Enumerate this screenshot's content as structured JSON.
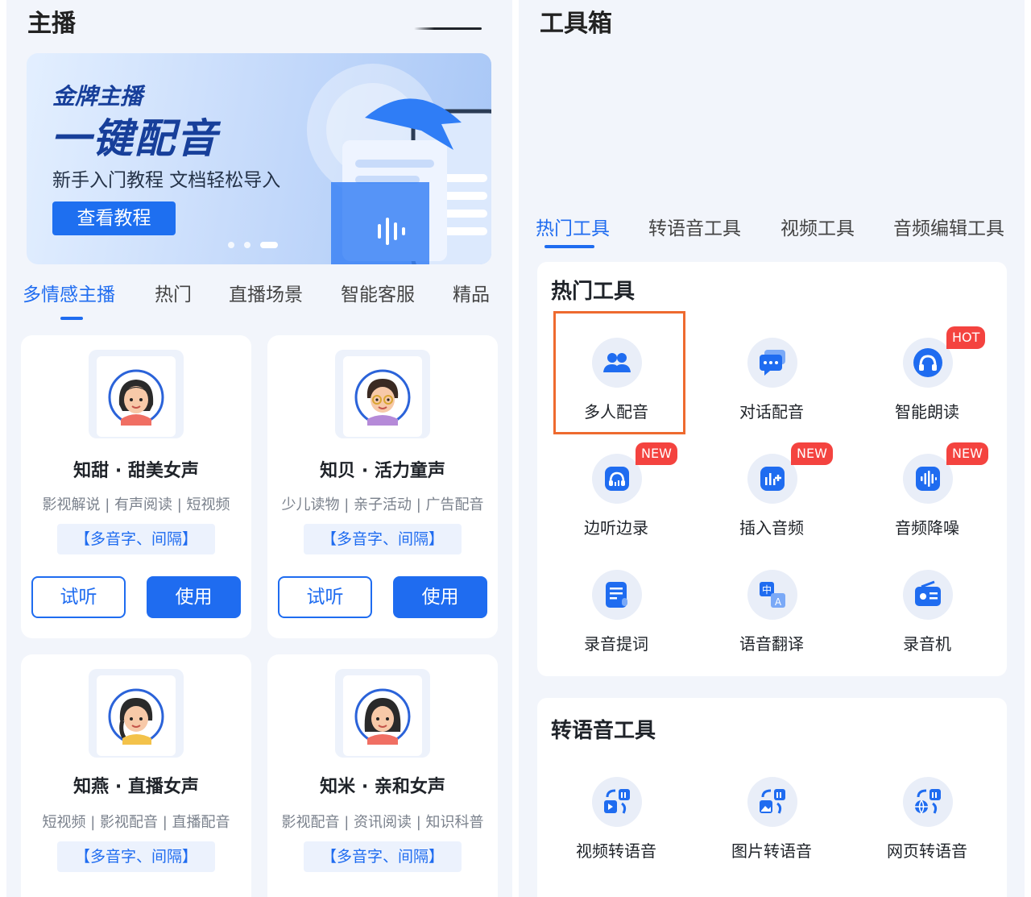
{
  "left": {
    "title": "主播",
    "banner": {
      "subtitle": "金牌主播",
      "headline": "一键配音",
      "description": "新手入门教程 文档轻松导入",
      "button": "查看教程"
    },
    "tabs": [
      "多情感主播",
      "热门",
      "直播场景",
      "智能客服",
      "精品"
    ],
    "voices": [
      {
        "name": "知甜 · 甜美女声",
        "tags": "影视解说 | 有声阅读 | 短视频",
        "badge": "【多音字、间隔】",
        "try": "试听",
        "use": "使用"
      },
      {
        "name": "知贝 · 活力童声",
        "tags": "少儿读物 | 亲子活动 | 广告配音",
        "badge": "【多音字、间隔】",
        "try": "试听",
        "use": "使用"
      },
      {
        "name": "知燕 · 直播女声",
        "tags": "短视频 | 影视配音 | 直播配音",
        "badge": "【多音字、间隔】"
      },
      {
        "name": "知米 · 亲和女声",
        "tags": "影视配音 | 资讯阅读 | 知识科普",
        "badge": "【多音字、间隔】"
      }
    ]
  },
  "right": {
    "title": "工具箱",
    "tabs": [
      "热门工具",
      "转语音工具",
      "视频工具",
      "音频编辑工具"
    ],
    "hot": {
      "title": "热门工具",
      "items": [
        {
          "label": "多人配音",
          "icon": "group-icon"
        },
        {
          "label": "对话配音",
          "icon": "chat-icon"
        },
        {
          "label": "智能朗读",
          "icon": "headphones-icon",
          "tag": "HOT"
        },
        {
          "label": "边听边录",
          "icon": "record-listen-icon",
          "tag": "NEW"
        },
        {
          "label": "插入音频",
          "icon": "insert-audio-icon",
          "tag": "NEW"
        },
        {
          "label": "音频降噪",
          "icon": "denoise-icon",
          "tag": "NEW"
        },
        {
          "label": "录音提词",
          "icon": "teleprompter-icon"
        },
        {
          "label": "语音翻译",
          "icon": "translate-icon"
        },
        {
          "label": "录音机",
          "icon": "recorder-icon"
        }
      ]
    },
    "convert": {
      "title": "转语音工具",
      "items": [
        {
          "label": "视频转语音",
          "icon": "video-to-speech-icon"
        },
        {
          "label": "图片转语音",
          "icon": "image-to-speech-icon"
        },
        {
          "label": "网页转语音",
          "icon": "web-to-speech-icon"
        }
      ]
    }
  },
  "colors": {
    "accent": "#1f6cf0",
    "tag": "#f4433f",
    "highlight": "#ee6a2f",
    "background": "#f2f5fb"
  }
}
